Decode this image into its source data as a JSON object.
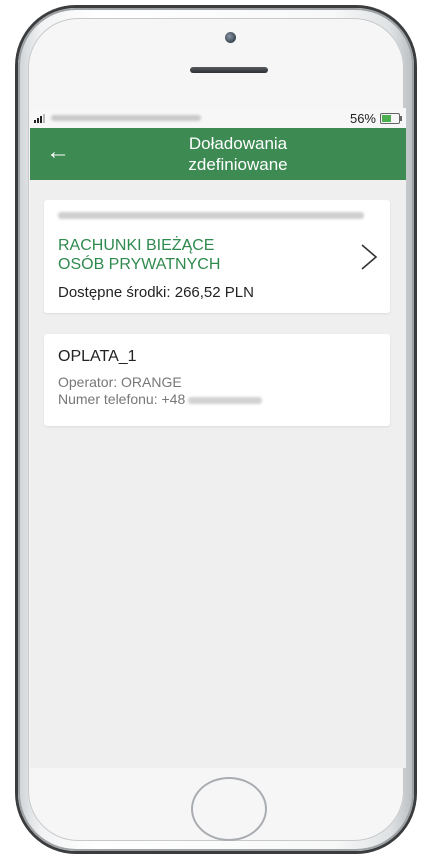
{
  "status_bar": {
    "battery_percent": "56%",
    "battery_level": 0.56,
    "battery_color": "#4caf50"
  },
  "header": {
    "title": "Doładowania\nzdefiniowane",
    "back_icon": "arrow-left-icon",
    "bg_color": "#3d8b53"
  },
  "account": {
    "name": "RACHUNKI BIEŻĄCE\nOSÓB PRYWATNYCH",
    "available": "Dostępne środki: 266,52 PLN",
    "name_color": "#2f8a4e",
    "chevron_icon": "chevron-right-icon"
  },
  "topups": [
    {
      "name": "OPLATA_1",
      "operator": "Operator: ORANGE",
      "phone_prefix": "Numer telefonu: +48"
    }
  ]
}
